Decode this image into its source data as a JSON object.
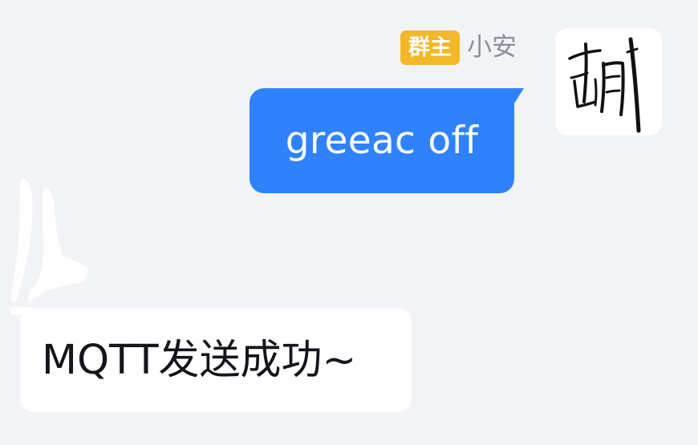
{
  "sender": {
    "role_badge": "群主",
    "name": "小安"
  },
  "messages": {
    "outgoing": "greeac off",
    "incoming": "MQTT发送成功~"
  },
  "icons": {
    "sender_avatar": "calligraphy-avatar-icon",
    "bot_avatar": "faded-avatar-icon"
  },
  "colors": {
    "background": "#f2f3f7",
    "outgoing_bubble": "#2f82fc",
    "incoming_bubble": "#ffffff",
    "role_badge": "#f5b72a",
    "sender_name": "#8e9099"
  }
}
